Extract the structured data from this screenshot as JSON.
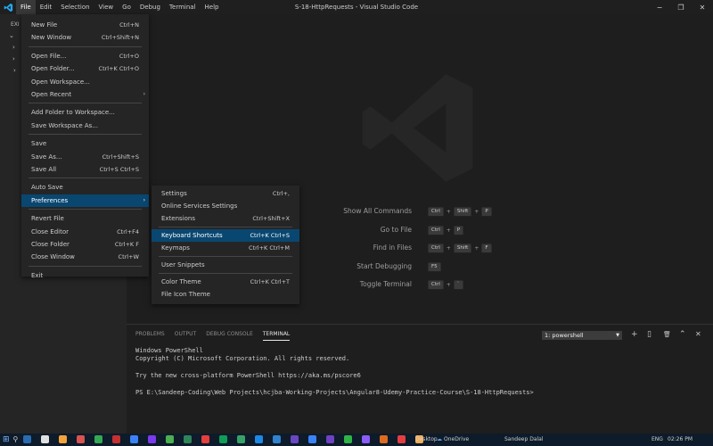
{
  "window": {
    "title": "S-18-HttpRequests - Visual Studio Code",
    "minimize_glyph": "−",
    "maximize_glyph": "❐",
    "close_glyph": "✕"
  },
  "menubar": [
    "File",
    "Edit",
    "Selection",
    "View",
    "Go",
    "Debug",
    "Terminal",
    "Help"
  ],
  "sidebar": {
    "header_label": "EXI",
    "chevrons": [
      "⌄",
      "›",
      "›",
      "›"
    ]
  },
  "file_menu": {
    "groups": [
      [
        {
          "label": "New File",
          "shortcut": "Ctrl+N"
        },
        {
          "label": "New Window",
          "shortcut": "Ctrl+Shift+N"
        }
      ],
      [
        {
          "label": "Open File...",
          "shortcut": "Ctrl+O"
        },
        {
          "label": "Open Folder...",
          "shortcut": "Ctrl+K Ctrl+O"
        },
        {
          "label": "Open Workspace...",
          "shortcut": ""
        },
        {
          "label": "Open Recent",
          "shortcut": "",
          "submenu": "›"
        }
      ],
      [
        {
          "label": "Add Folder to Workspace...",
          "shortcut": ""
        },
        {
          "label": "Save Workspace As...",
          "shortcut": ""
        }
      ],
      [
        {
          "label": "Save",
          "shortcut": ""
        },
        {
          "label": "Save As...",
          "shortcut": "Ctrl+Shift+S"
        },
        {
          "label": "Save All",
          "shortcut": "Ctrl+S Ctrl+S"
        }
      ],
      [
        {
          "label": "Auto Save",
          "shortcut": ""
        },
        {
          "label": "Preferences",
          "shortcut": "",
          "submenu": "›",
          "active": true
        }
      ],
      [
        {
          "label": "Revert File",
          "shortcut": ""
        },
        {
          "label": "Close Editor",
          "shortcut": "Ctrl+F4"
        },
        {
          "label": "Close Folder",
          "shortcut": "Ctrl+K F"
        },
        {
          "label": "Close Window",
          "shortcut": "Ctrl+W"
        }
      ],
      [
        {
          "label": "Exit",
          "shortcut": ""
        }
      ]
    ]
  },
  "preferences_menu": {
    "groups": [
      [
        {
          "label": "Settings",
          "shortcut": "Ctrl+,"
        },
        {
          "label": "Online Services Settings",
          "shortcut": ""
        },
        {
          "label": "Extensions",
          "shortcut": "Ctrl+Shift+X"
        }
      ],
      [
        {
          "label": "Keyboard Shortcuts",
          "shortcut": "Ctrl+K Ctrl+S",
          "active": true
        },
        {
          "label": "Keymaps",
          "shortcut": "Ctrl+K Ctrl+M"
        }
      ],
      [
        {
          "label": "User Snippets",
          "shortcut": ""
        }
      ],
      [
        {
          "label": "Color Theme",
          "shortcut": "Ctrl+K Ctrl+T"
        },
        {
          "label": "File Icon Theme",
          "shortcut": ""
        }
      ]
    ]
  },
  "shortcuts": [
    {
      "label": "Show All Commands",
      "keys": [
        "Ctrl",
        "Shift",
        "P"
      ]
    },
    {
      "label": "Go to File",
      "keys": [
        "Ctrl",
        "P"
      ]
    },
    {
      "label": "Find in Files",
      "keys": [
        "Ctrl",
        "Shift",
        "F"
      ]
    },
    {
      "label": "Start Debugging",
      "keys": [
        "F5"
      ]
    },
    {
      "label": "Toggle Terminal",
      "keys": [
        "Ctrl",
        "`"
      ]
    }
  ],
  "panel": {
    "tabs": [
      "PROBLEMS",
      "OUTPUT",
      "DEBUG CONSOLE",
      "TERMINAL"
    ],
    "active_tab": "TERMINAL",
    "terminal_select": "1: powershell",
    "icons": [
      "+",
      "▯",
      "🗑",
      "⌃",
      "✕"
    ],
    "terminal_lines": [
      "Windows PowerShell",
      "Copyright (C) Microsoft Corporation. All rights reserved.",
      "",
      "Try the new cross-platform PowerShell https://aka.ms/pscore6",
      "",
      "PS E:\\Sandeep-Coding\\Web Projects\\hcjba-Working-Projects\\Angular8-Udemy-Practice-Course\\S-18-HttpRequests>"
    ]
  },
  "taskbar": {
    "desktop_label": "Desktop",
    "onedrive_label": "OneDrive",
    "user_label": "Sandeep Dalal",
    "language": "ENG",
    "time": "02:26 PM",
    "icon_colors": [
      "#2b6cb0",
      "#e0e0e0",
      "#f2a33a",
      "#d9534f",
      "#34a853",
      "#c53030",
      "#3b82f6",
      "#7c3aed",
      "#4caf50",
      "#2f855a",
      "#e53e3e",
      "#0f9d58",
      "#38a169",
      "#1e88e5",
      "#3182ce",
      "#6b46c1",
      "#3b82f6",
      "#6f42c1",
      "#2fb344",
      "#8b5cf6",
      "#dd6b20",
      "#e53e3e",
      "#f6ad55"
    ]
  },
  "colors": {
    "menu_highlight": "#094771",
    "accent": "#007acc"
  }
}
